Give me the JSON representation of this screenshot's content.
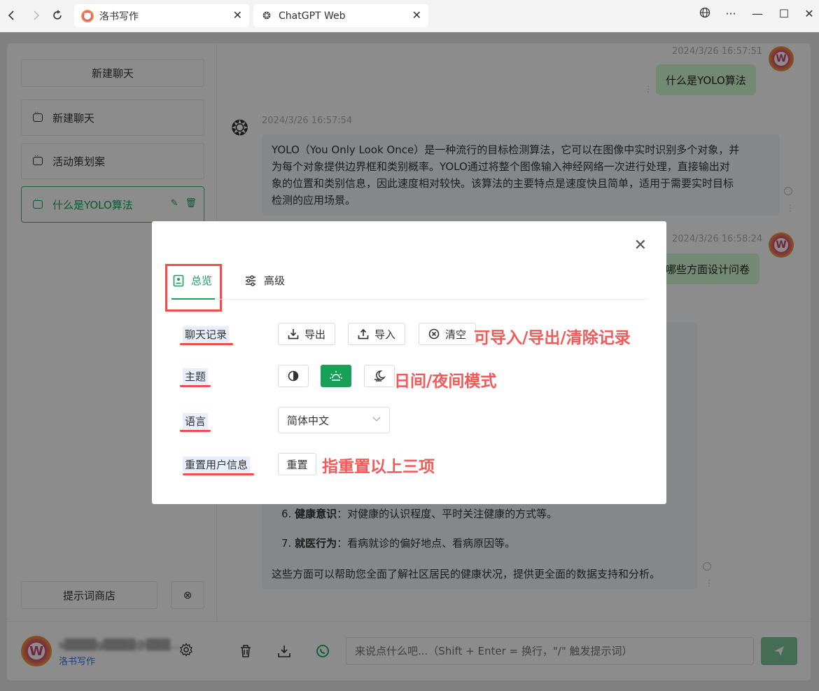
{
  "browser": {
    "tabs": [
      {
        "title": "洛书写作"
      },
      {
        "title": "ChatGPT Web"
      }
    ]
  },
  "sidebar": {
    "new_chat_button": "新建聊天",
    "chats": [
      {
        "label": "新建聊天"
      },
      {
        "label": "活动策划案"
      },
      {
        "label": "什么是YOLO算法"
      }
    ],
    "prompt_store_button": "提示词商店",
    "user": {
      "name": "s▒▒▒▒g▒▒▒▒@▒▒▒...",
      "subtitle": "洛书写作"
    }
  },
  "messages": [
    {
      "role": "user",
      "time": "2024/3/26 16:57:51",
      "text": "什么是YOLO算法"
    },
    {
      "role": "assistant",
      "time": "2024/3/26 16:57:54",
      "lines": [
        "YOLO（You Only Look Once）是一种流行的目标检测算法，它可以在图像中实时识别多个对象，并",
        "为每个对象提供边界框和类别概率。YOLO通过将整个图像输入神经网络一次进行处理，直接输出对",
        "象的位置和类别信息，因此速度相对较快。该算法的主要特点是速度快且简单，适用于需要实时目标",
        "检测的应用场景。"
      ]
    },
    {
      "role": "user",
      "time": "2024/3/26 16:58:24",
      "text": "哪些方面设计问卷"
    },
    {
      "role": "assistant",
      "items": [
        {
          "num": "6.",
          "bold": "健康意识",
          "rest": "：对健康的认识程度、平时关注健康的方式等。"
        },
        {
          "num": "7.",
          "bold": "就医行为",
          "rest": "：看病就诊的偏好地点、看病原因等。"
        }
      ],
      "summary": "这些方面可以帮助您全面了解社区居民的健康状况，提供更全面的数据支持和分析。"
    }
  ],
  "input": {
    "placeholder": "来说点什么吧...（Shift + Enter = 换行，\"/\" 触发提示词）"
  },
  "settings": {
    "tabs": [
      {
        "label": "总览"
      },
      {
        "label": "高级"
      }
    ],
    "rows": {
      "history": {
        "label": "聊天记录",
        "export": "导出",
        "import": "导入",
        "clear": "清空"
      },
      "theme": {
        "label": "主题"
      },
      "language": {
        "label": "语言",
        "value": "简体中文"
      },
      "reset": {
        "label": "重置用户信息",
        "button": "重置"
      }
    },
    "annotations": {
      "history": "可导入/导出/清除记录",
      "theme": "日间/夜间模式",
      "reset": "指重置以上三项"
    }
  },
  "colors": {
    "accent": "#18a058",
    "annotation": "#f25a5a",
    "user_bubble": "#d2f9d1"
  }
}
